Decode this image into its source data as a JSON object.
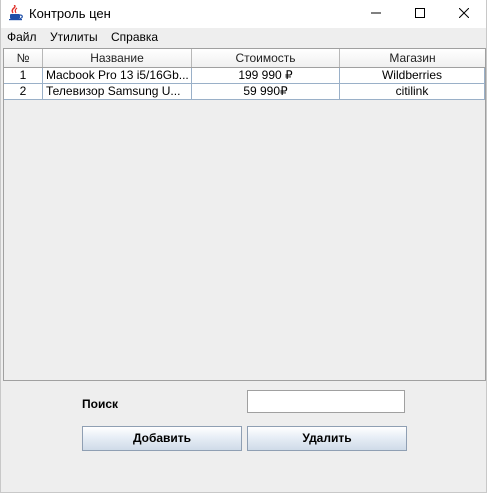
{
  "window": {
    "title": "Контроль цен",
    "icon": "java-cup-icon"
  },
  "menubar": {
    "items": [
      {
        "label": "Файл"
      },
      {
        "label": "Утилиты"
      },
      {
        "label": "Справка"
      }
    ]
  },
  "table": {
    "columns": [
      "№",
      "Название",
      "Стоимость",
      "Магазин"
    ],
    "rows": [
      [
        "1",
        "Macbook Pro 13 i5/16Gb...",
        "199 990 ₽",
        "Wildberries"
      ],
      [
        "2",
        "Телевизор Samsung U...",
        "59 990₽",
        "citilink"
      ]
    ]
  },
  "search": {
    "label": "Поиск",
    "value": "",
    "placeholder": ""
  },
  "buttons": {
    "add_label": "Добавить",
    "delete_label": "Удалить"
  }
}
